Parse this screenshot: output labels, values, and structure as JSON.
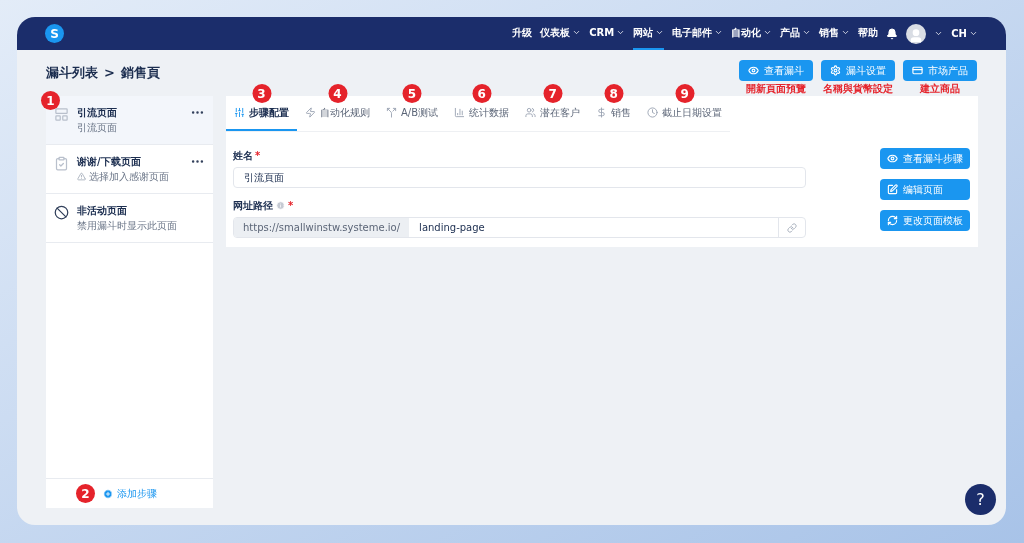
{
  "nav": {
    "logo": "S",
    "items": [
      {
        "label": "升级",
        "dropdown": false,
        "selected": false
      },
      {
        "label": "仪表板",
        "dropdown": true,
        "selected": false
      },
      {
        "label": "CRM",
        "dropdown": true,
        "selected": false
      },
      {
        "label": "网站",
        "dropdown": true,
        "selected": true
      },
      {
        "label": "电子邮件",
        "dropdown": true,
        "selected": false
      },
      {
        "label": "自动化",
        "dropdown": true,
        "selected": false
      },
      {
        "label": "产品",
        "dropdown": true,
        "selected": false
      },
      {
        "label": "销售",
        "dropdown": true,
        "selected": false
      },
      {
        "label": "帮助",
        "dropdown": false,
        "selected": false
      }
    ],
    "user": "CH"
  },
  "breadcrumb": {
    "parent": "漏斗列表",
    "separator": ">",
    "current": "銷售頁"
  },
  "header_buttons": [
    {
      "label": "查看漏斗",
      "caption": "開新頁面預覽"
    },
    {
      "label": "漏斗设置",
      "caption": "名稱與貨幣設定"
    },
    {
      "label": "市场产品",
      "caption": "建立商品"
    }
  ],
  "sidebar": {
    "marker": "1",
    "steps": [
      {
        "title": "引流页面",
        "subtitle": "引流页面",
        "warning": false,
        "menu": true,
        "selected": true
      },
      {
        "title": "谢谢/下载页面",
        "subtitle": "选择加入感谢页面",
        "warning": true,
        "menu": true,
        "selected": false
      },
      {
        "title": "非活动页面",
        "subtitle": "禁用漏斗时显示此页面",
        "warning": false,
        "menu": false,
        "selected": false
      }
    ],
    "add": {
      "marker": "2",
      "label": "添加步骤"
    }
  },
  "tabs": [
    {
      "label": "步骤配置",
      "marker": "3",
      "selected": true
    },
    {
      "label": "自动化规则",
      "marker": "4",
      "selected": false
    },
    {
      "label": "A/B测试",
      "marker": "5",
      "selected": false
    },
    {
      "label": "统计数据",
      "marker": "6",
      "selected": false
    },
    {
      "label": "潜在客户",
      "marker": "7",
      "selected": false
    },
    {
      "label": "销售",
      "marker": "8",
      "selected": false
    },
    {
      "label": "截止日期设置",
      "marker": "9",
      "selected": false
    }
  ],
  "form": {
    "name": {
      "label": "姓名",
      "required": "*",
      "value": "引流頁面"
    },
    "path": {
      "label": "网址路径",
      "required": "*",
      "prefix": "https://smallwinstw.systeme.io/",
      "value": "landing-page"
    }
  },
  "side_buttons": [
    {
      "label": "查看漏斗步骤"
    },
    {
      "label": "编辑页面"
    },
    {
      "label": "更改页面模板"
    }
  ],
  "help": "?"
}
